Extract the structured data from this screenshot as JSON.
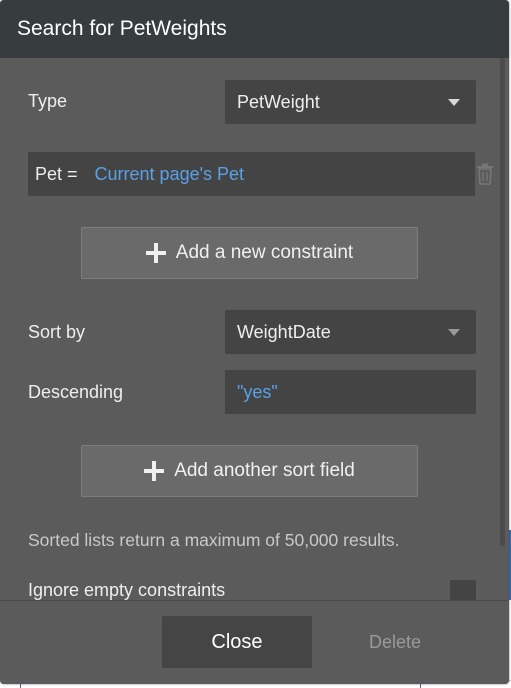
{
  "dialog": {
    "title": "Search for PetWeights",
    "type_label": "Type",
    "type_value": "PetWeight",
    "constraint": {
      "field": "Pet =",
      "value": "Current page's Pet"
    },
    "add_constraint_label": "Add a new constraint",
    "sort_by_label": "Sort by",
    "sort_by_value": "WeightDate",
    "descending_label": "Descending",
    "descending_value": "\"yes\"",
    "add_sort_label": "Add another sort field",
    "note": "Sorted lists return a maximum of 50,000 results.",
    "ignore_label": "Ignore empty constraints",
    "close_label": "Close",
    "delete_label": "Delete"
  },
  "colors": {
    "header_bg": "#373c3f",
    "panel_bg": "#5b5b5b",
    "field_bg": "#444444",
    "link_blue": "#5aa0e8"
  }
}
